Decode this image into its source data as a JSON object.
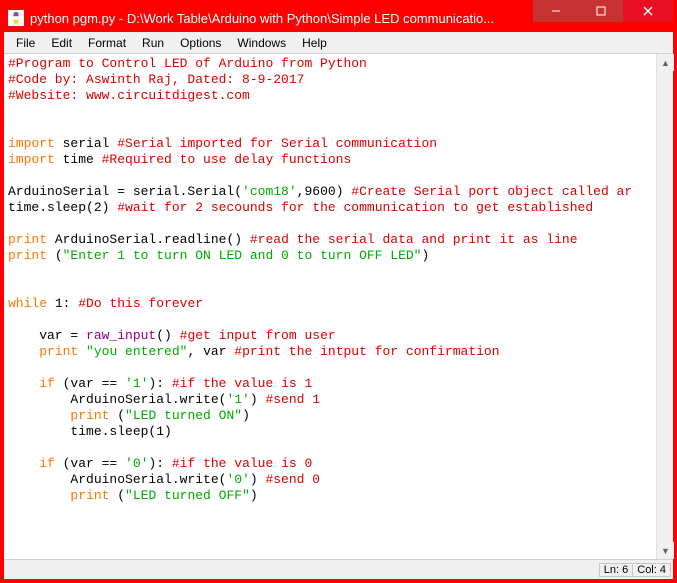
{
  "title": "python pgm.py - D:\\Work Table\\Arduino with Python\\Simple LED communicatio...",
  "menu": [
    "File",
    "Edit",
    "Format",
    "Run",
    "Options",
    "Windows",
    "Help"
  ],
  "status": {
    "line": "Ln: 6",
    "col": "Col: 4"
  },
  "code": {
    "l1_c": "#Program to Control LED of Arduino from Python",
    "l2_c": "#Code by: Aswinth Raj, Dated: 8-9-2017",
    "l3_c": "#Website: www.circuitdigest.com",
    "l6_kw1": "import",
    "l6_t": " serial ",
    "l6_c": "#Serial imported for Serial communication",
    "l7_kw1": "import",
    "l7_t": " time ",
    "l7_c": "#Required to use delay functions",
    "l9_t1": "ArduinoSerial = serial.Serial(",
    "l9_s": "'com18'",
    "l9_t2": ",",
    "l9_n": "9600",
    "l9_t3": ") ",
    "l9_c": "#Create Serial port object called ar",
    "l10_t1": "time.sleep(",
    "l10_n": "2",
    "l10_t2": ") ",
    "l10_c": "#wait for 2 secounds for the communication to get established",
    "l12_kw": "print",
    "l12_t": " ArduinoSerial.readline() ",
    "l12_c": "#read the serial data and print it as line",
    "l13_kw": "print",
    "l13_t": " (",
    "l13_s": "\"Enter 1 to turn ON LED and 0 to turn OFF LED\"",
    "l13_t2": ")",
    "l16_kw": "while",
    "l16_t": " ",
    "l16_n": "1",
    "l16_t2": ": ",
    "l16_c": "#Do this forever",
    "l18_t1": "    var = ",
    "l18_bi": "raw_input",
    "l18_t2": "() ",
    "l18_c": "#get input from user",
    "l19_t1": "    ",
    "l19_kw": "print",
    "l19_t2": " ",
    "l19_s": "\"you entered\"",
    "l19_t3": ", var ",
    "l19_c": "#print the intput for confirmation",
    "l21_t1": "    ",
    "l21_kw": "if",
    "l21_t2": " (var == ",
    "l21_s": "'1'",
    "l21_t3": "): ",
    "l21_c": "#if the value is 1",
    "l22_t1": "        ArduinoSerial.write(",
    "l22_s": "'1'",
    "l22_t2": ") ",
    "l22_c": "#send 1",
    "l23_t1": "        ",
    "l23_kw": "print",
    "l23_t2": " (",
    "l23_s": "\"LED turned ON\"",
    "l23_t3": ")",
    "l24_t1": "        time.sleep(",
    "l24_n": "1",
    "l24_t2": ")",
    "l26_t1": "    ",
    "l26_kw": "if",
    "l26_t2": " (var == ",
    "l26_s": "'0'",
    "l26_t3": "): ",
    "l26_c": "#if the value is 0",
    "l27_t1": "        ArduinoSerial.write(",
    "l27_s": "'0'",
    "l27_t2": ") ",
    "l27_c": "#send 0",
    "l28_t1": "        ",
    "l28_kw": "print",
    "l28_t2": " (",
    "l28_s": "\"LED turned OFF\"",
    "l28_t3": ")"
  }
}
